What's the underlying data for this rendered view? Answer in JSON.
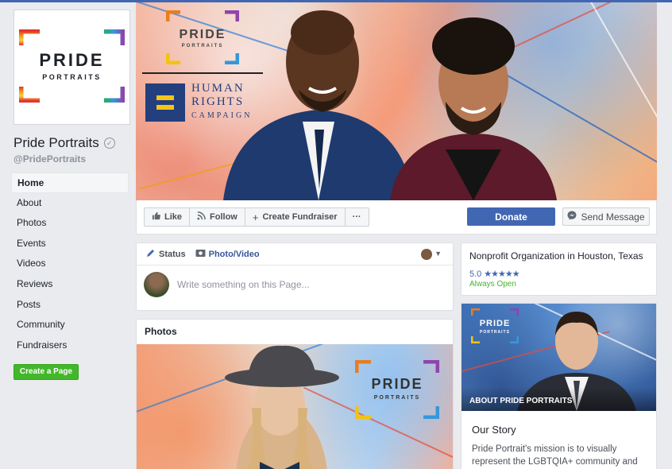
{
  "sidebar": {
    "page_name": "Pride Portraits",
    "handle": "@PridePortraits",
    "logo_line1": "PRIDE",
    "logo_line2": "PORTRAITS",
    "nav": [
      "Home",
      "About",
      "Photos",
      "Events",
      "Videos",
      "Reviews",
      "Posts",
      "Community",
      "Fundraisers"
    ],
    "active": "Home",
    "create_page": "Create a Page"
  },
  "cover": {
    "logo_line1": "PRIDE",
    "logo_line2": "PORTRAITS",
    "hrc_line1": "HUMAN",
    "hrc_line2": "RIGHTS",
    "hrc_line3": "CAMPAIGN"
  },
  "actions": {
    "like": "Like",
    "follow": "Follow",
    "create_fundraiser": "Create Fundraiser",
    "more": "···",
    "donate": "Donate",
    "send_message": "Send Message"
  },
  "composer": {
    "tab_status": "Status",
    "tab_photo": "Photo/Video",
    "placeholder": "Write something on this Page..."
  },
  "photos": {
    "title": "Photos",
    "logo_line1": "PRIDE",
    "logo_line2": "PORTRAITS"
  },
  "info": {
    "category": "Nonprofit Organization in Houston, Texas",
    "rating": "5.0",
    "stars": "★★★★★",
    "hours": "Always Open"
  },
  "about": {
    "image_label": "ABOUT PRIDE PORTRAITS",
    "logo_line1": "PRIDE",
    "logo_line2": "PORTRAITS",
    "story_title": "Our Story",
    "story_text": "Pride Portrait's mission is to visually represent the LGBTQIA+ community and"
  },
  "colors": {
    "facebook_blue": "#4267b2",
    "link_blue": "#365899",
    "green": "#42b72a",
    "background": "#e9ebee",
    "hrc_navy": "#233f7d",
    "hrc_yellow": "#f5c518"
  }
}
